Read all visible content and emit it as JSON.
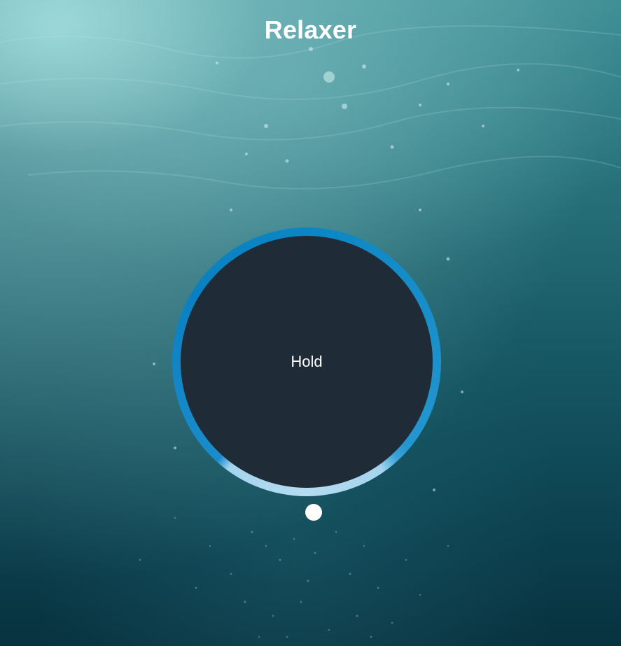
{
  "app": {
    "title": "Relaxer"
  },
  "breathing": {
    "status": "Hold",
    "colors": {
      "inner": "#202b38",
      "ring_active": "#0b86c4",
      "ring_light": "#b4dcf1"
    }
  },
  "background": {
    "description_icon": "underwater-bubbles-image"
  }
}
